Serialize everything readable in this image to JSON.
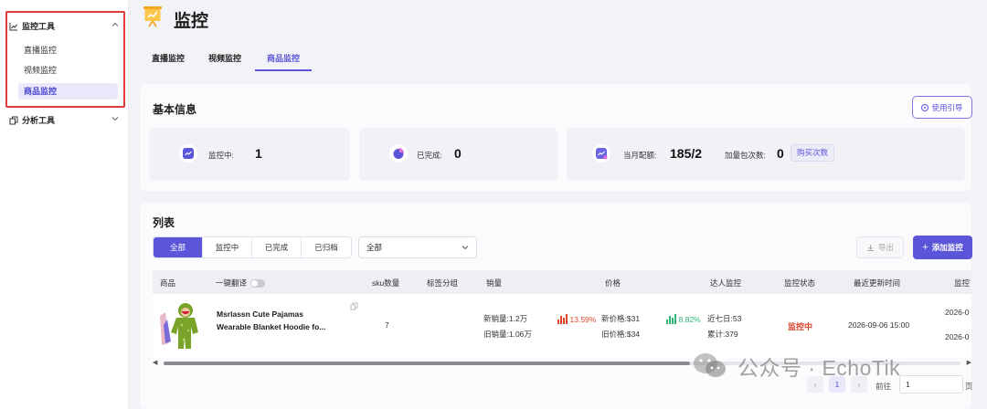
{
  "sidebar": {
    "groups": [
      {
        "label": "监控工具",
        "expanded": true,
        "items": [
          {
            "label": "直播监控",
            "active": false
          },
          {
            "label": "视频监控",
            "active": false
          },
          {
            "label": "商品监控",
            "active": true
          }
        ]
      },
      {
        "label": "分析工具",
        "expanded": false
      }
    ]
  },
  "header": {
    "title": "监控",
    "icon": "presentation-chart-icon"
  },
  "tabs": [
    {
      "label": "直播监控",
      "active": false
    },
    {
      "label": "视频监控",
      "active": false
    },
    {
      "label": "商品监控",
      "active": true
    }
  ],
  "basic_info": {
    "title": "基本信息",
    "guide_label": "使用引导",
    "monitoring": {
      "label": "监控中:",
      "value": "1"
    },
    "completed": {
      "label": "已完成:",
      "value": "0"
    },
    "quota": {
      "label": "当月配额:",
      "value": "185/2"
    },
    "extra": {
      "label": "加量包次数:",
      "value": "0"
    },
    "buy_label": "购买次数"
  },
  "list": {
    "title": "列表",
    "filters": [
      "全部",
      "监控中",
      "已完成",
      "已归档"
    ],
    "active_filter": 0,
    "select_value": "全部",
    "export_label": "导出",
    "add_label": "添加监控",
    "columns": {
      "product": "商品",
      "translate": "一键翻译",
      "sku": "sku数量",
      "tag": "标签分组",
      "sales": "销量",
      "price": "价格",
      "creator": "达人监控",
      "status": "监控状态",
      "updated": "最近更新时间",
      "monitor_time": "监控"
    },
    "rows": [
      {
        "name_line1": "Msrlassn Cute Pajamas",
        "name_line2": "Wearable Blanket Hoodie fo...",
        "sku": "7",
        "new_sales": "新销量:1.2万",
        "old_sales": "旧销量:1.06万",
        "sales_change": "13.59%",
        "new_price": "新价格:$31",
        "old_price": "旧价格:$34",
        "price_change": "8.82%",
        "recent7": "近七日:53",
        "total": "累计:379",
        "status": "监控中",
        "updated": "2026-09-06 15:00",
        "monitor_time_1": "2026-0",
        "monitor_time_2": "2026-0"
      }
    ]
  },
  "pagination": {
    "current": "1",
    "goto_label": "前往",
    "goto_value": "1",
    "page_suffix": "页"
  },
  "watermark": {
    "text": "公众号 · EchoTik"
  },
  "colors": {
    "accent": "#5b55d9",
    "status_red": "#e0452b",
    "up_red": "#e0452b",
    "up_green": "#2bb673",
    "highlight_border": "#e03c3c"
  }
}
